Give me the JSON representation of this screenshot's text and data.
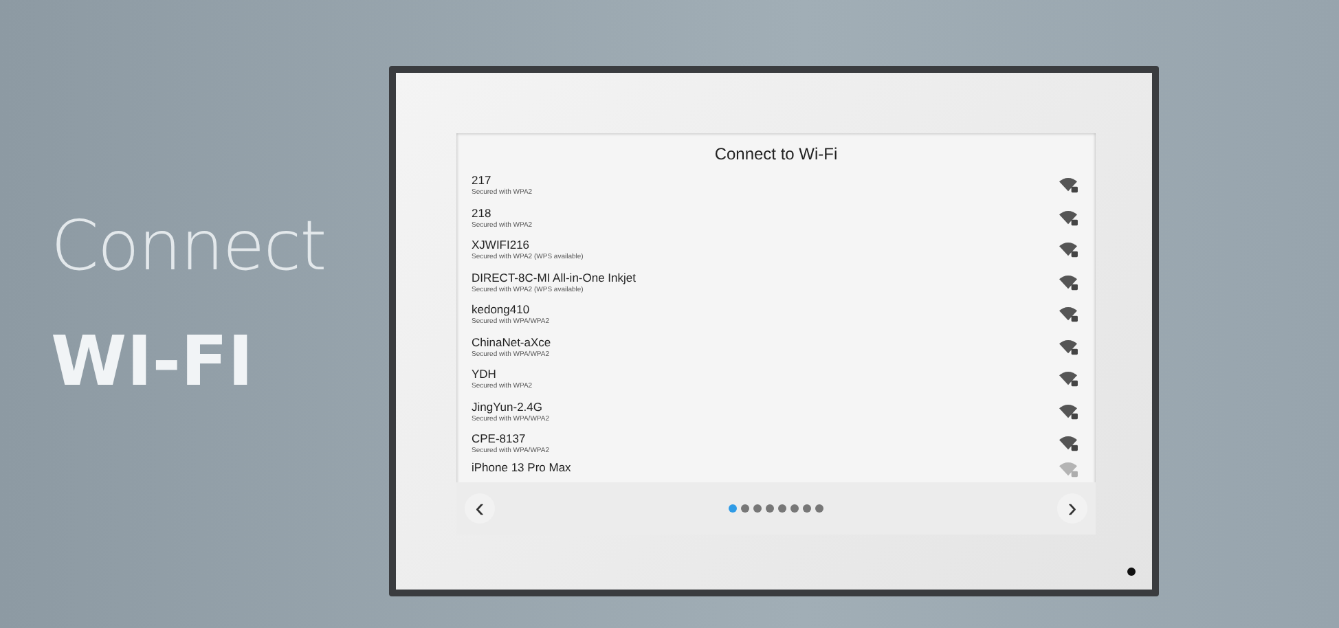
{
  "headline": {
    "line_1": "Connect",
    "line_2": "WI-FI"
  },
  "screen": {
    "title": "Connect to Wi-Fi",
    "networks": [
      {
        "name": "217",
        "security": "Secured with WPA2"
      },
      {
        "name": "218",
        "security": "Secured with WPA2"
      },
      {
        "name": "XJWIFI216",
        "security": "Secured with WPA2 (WPS available)"
      },
      {
        "name": "DIRECT-8C-MI All-in-One Inkjet",
        "security": "Secured with WPA2 (WPS available)"
      },
      {
        "name": "kedong410",
        "security": "Secured with WPA/WPA2"
      },
      {
        "name": "ChinaNet-aXce",
        "security": "Secured with WPA/WPA2"
      },
      {
        "name": "YDH",
        "security": "Secured with WPA2"
      },
      {
        "name": "JingYun-2.4G",
        "security": "Secured with WPA/WPA2"
      },
      {
        "name": "CPE-8137",
        "security": "Secured with WPA/WPA2"
      },
      {
        "name": "iPhone 13 Pro Max"
      }
    ],
    "prev": "‹",
    "next": "›",
    "pages": [
      {
        "selected": true
      },
      {
        "selected": false
      },
      {
        "selected": false
      },
      {
        "selected": false
      },
      {
        "selected": false
      },
      {
        "selected": false
      },
      {
        "selected": false
      },
      {
        "selected": false
      }
    ]
  }
}
